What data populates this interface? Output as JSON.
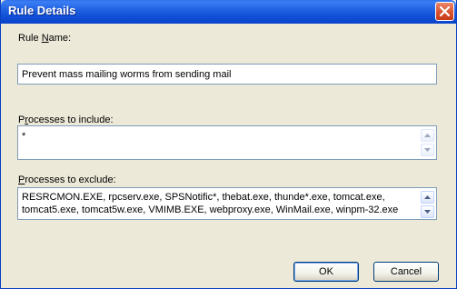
{
  "window": {
    "title": "Rule Details"
  },
  "rule_name": {
    "label_prefix": "Rule ",
    "label_accel": "N",
    "label_suffix": "ame:",
    "value": "Prevent mass mailing worms from sending mail"
  },
  "include": {
    "label_prefix": "P",
    "label_accel": "r",
    "label_suffix": "ocesses to include:",
    "value": "*"
  },
  "exclude": {
    "label_prefix": "",
    "label_accel": "P",
    "label_suffix": "rocesses to exclude:",
    "value": "RESRCMON.EXE, rpcserv.exe, SPSNotific*, thebat.exe, thunde*.exe, tomcat.exe, tomcat5.exe, tomcat5w.exe, VMIMB.EXE, webproxy.exe, WinMail.exe, winpm-32.exe"
  },
  "buttons": {
    "ok": "OK",
    "cancel": "Cancel"
  },
  "icons": [
    "close-icon",
    "scroll-up-icon",
    "scroll-down-icon"
  ],
  "colors": {
    "titlebar": "#0a43c9",
    "close_button": "#d8542f",
    "dialog_bg": "#ece9d8",
    "field_border": "#7f9db9"
  }
}
